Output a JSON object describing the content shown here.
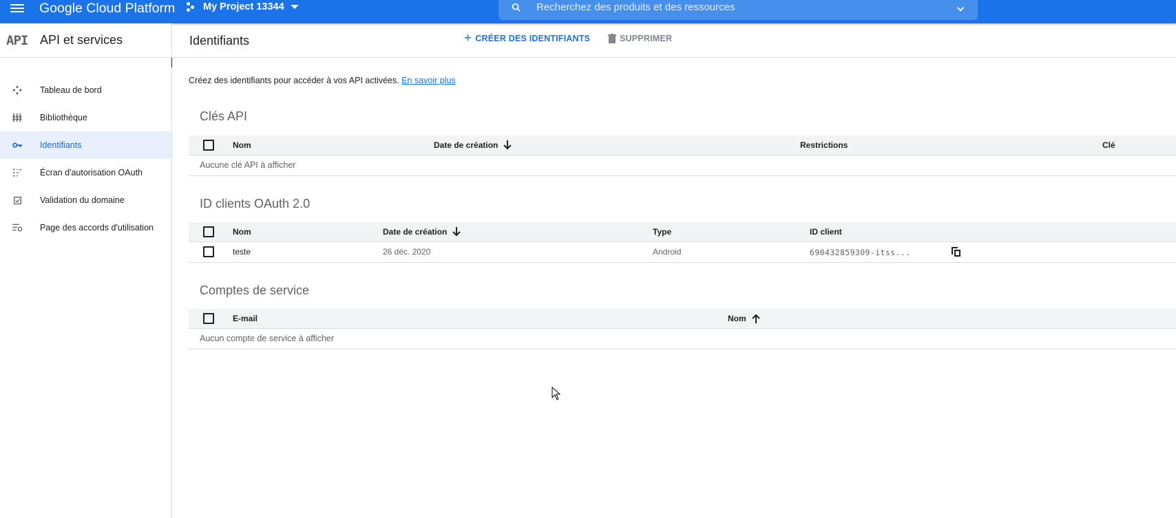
{
  "topbar": {
    "platform_title": "Google Cloud Platform",
    "project_name": "My Project 13344",
    "search_placeholder": "Recherchez des produits et des ressources"
  },
  "sidebar": {
    "logo_text": "API",
    "service_title": "API et services",
    "items": [
      {
        "label": "Tableau de bord",
        "icon": "dashboard-icon"
      },
      {
        "label": "Bibliothèque",
        "icon": "library-icon"
      },
      {
        "label": "Identifiants",
        "icon": "key-icon",
        "active": true
      },
      {
        "label": "Écran d'autorisation OAuth",
        "icon": "consent-icon"
      },
      {
        "label": "Validation du domaine",
        "icon": "checkbox-icon"
      },
      {
        "label": "Page des accords d'utilisation",
        "icon": "settings-list-icon"
      }
    ]
  },
  "header": {
    "title": "Identifiants",
    "create_label": "CRÉER DES IDENTIFIANTS",
    "delete_label": "SUPPRIMER"
  },
  "main": {
    "intro_text": "Créez des identifiants pour accéder à vos API activées.",
    "learn_more": "En savoir plus",
    "api_keys": {
      "title": "Clés API",
      "columns": [
        "Nom",
        "Date de création",
        "Restrictions",
        "Clé"
      ],
      "empty_text": "Aucune clé API à afficher"
    },
    "oauth": {
      "title": "ID clients OAuth 2.0",
      "columns": [
        "Nom",
        "Date de création",
        "Type",
        "ID client"
      ],
      "rows": [
        {
          "name": "teste",
          "date": "26 déc. 2020",
          "type": "Android",
          "client_id": "690432859309-itss..."
        }
      ]
    },
    "service_accounts": {
      "title": "Comptes de service",
      "columns": [
        "E-mail",
        "Nom"
      ],
      "empty_text": "Aucun compte de service à afficher"
    }
  },
  "colors": {
    "brand_blue": "#1a73e8",
    "active_bg": "#e8f0fe",
    "header_bg": "#f1f3f4"
  }
}
